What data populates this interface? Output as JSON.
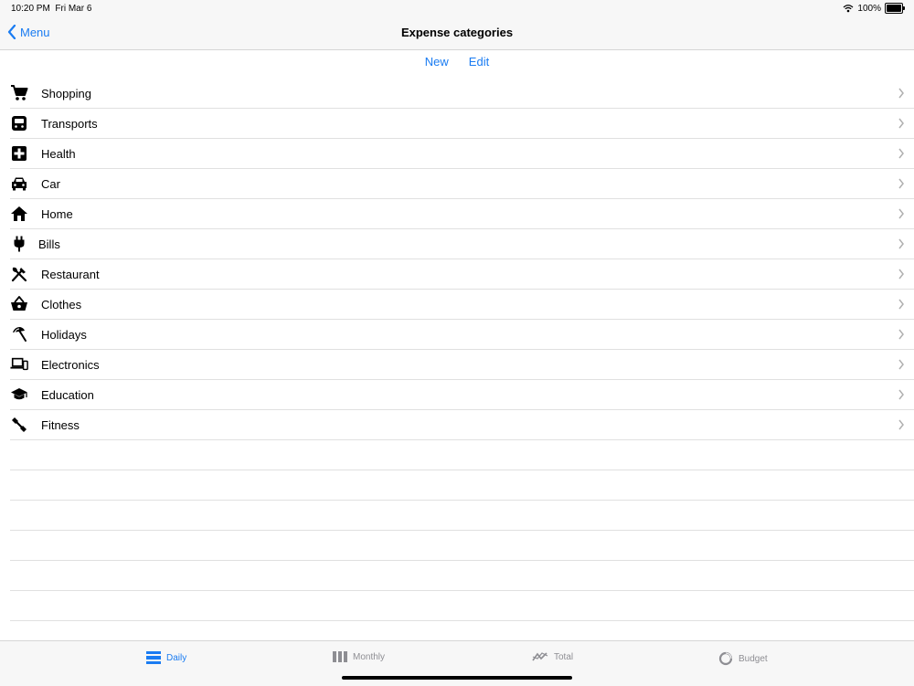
{
  "status": {
    "time": "10:20 PM",
    "date": "Fri Mar 6",
    "battery": "100%"
  },
  "nav": {
    "back_label": "Menu",
    "title": "Expense categories"
  },
  "actions": {
    "new_label": "New",
    "edit_label": "Edit"
  },
  "categories": [
    {
      "label": "Shopping",
      "icon": "shopping-cart-icon"
    },
    {
      "label": "Transports",
      "icon": "bus-icon"
    },
    {
      "label": "Health",
      "icon": "medical-cross-icon"
    },
    {
      "label": "Car",
      "icon": "car-icon"
    },
    {
      "label": "Home",
      "icon": "house-icon"
    },
    {
      "label": "Bills",
      "icon": "plug-icon"
    },
    {
      "label": "Restaurant",
      "icon": "fork-knife-icon"
    },
    {
      "label": "Clothes",
      "icon": "basket-icon"
    },
    {
      "label": "Holidays",
      "icon": "beach-umbrella-icon"
    },
    {
      "label": "Electronics",
      "icon": "devices-icon"
    },
    {
      "label": "Education",
      "icon": "graduation-cap-icon"
    },
    {
      "label": "Fitness",
      "icon": "dumbbell-icon"
    }
  ],
  "tabs": [
    {
      "label": "Daily",
      "icon": "daily-list-icon",
      "active": true
    },
    {
      "label": "Monthly",
      "icon": "monthly-bars-icon",
      "active": false
    },
    {
      "label": "Total",
      "icon": "trend-icon",
      "active": false
    },
    {
      "label": "Budget",
      "icon": "donut-icon",
      "active": false
    }
  ],
  "colors": {
    "accent": "#1a7cf2",
    "inactive": "#8e8e93",
    "bar_bg": "#f7f7f7",
    "separator": "#e0e0e0"
  }
}
